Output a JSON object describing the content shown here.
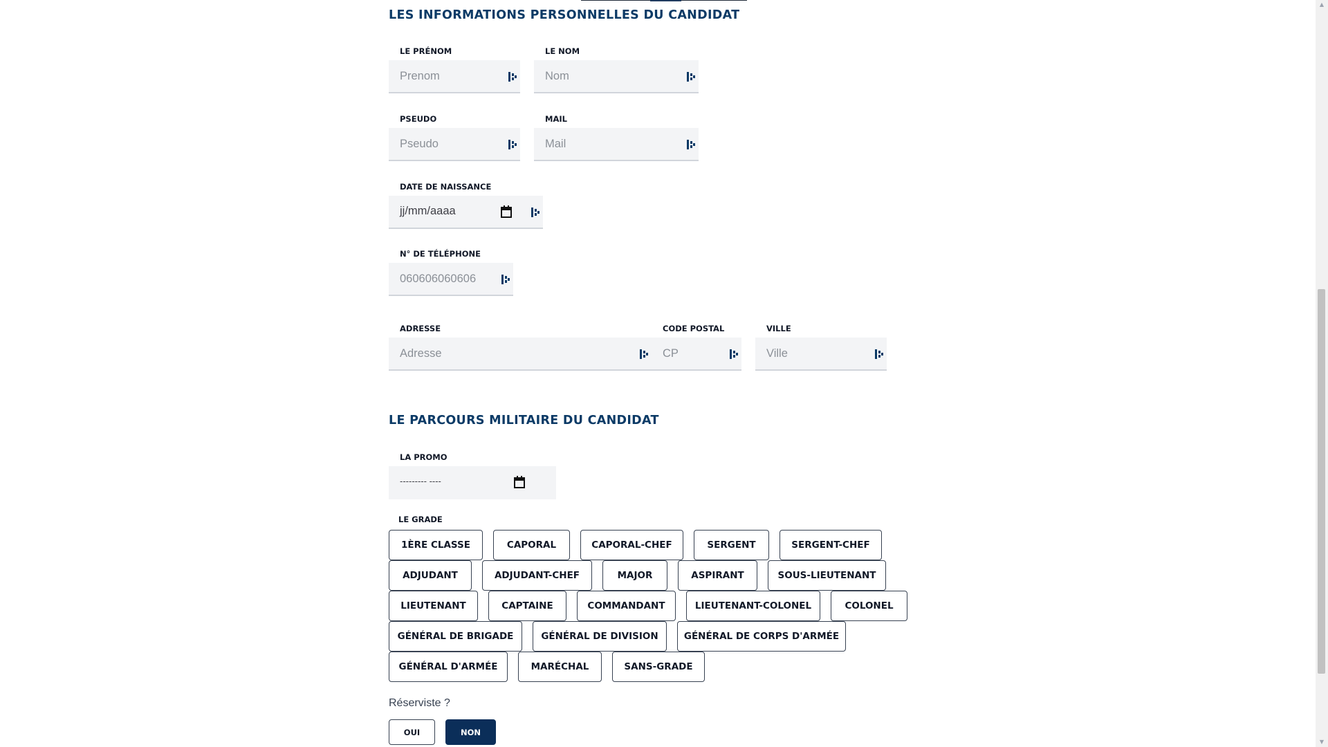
{
  "personal": {
    "title": "LES INFORMATIONS PERSONNELLES DU CANDIDAT",
    "firstname": {
      "label": "LE PRÉNOM",
      "placeholder": "Prenom"
    },
    "lastname": {
      "label": "LE NOM",
      "placeholder": "Nom"
    },
    "pseudo": {
      "label": "PSEUDO",
      "placeholder": "Pseudo"
    },
    "mail": {
      "label": "MAIL",
      "placeholder": "Mail"
    },
    "birthdate": {
      "label": "DATE DE NAISSANCE",
      "placeholder": "jj/mm/aaaa"
    },
    "phone": {
      "label": "N° DE TÉLÉPHONE",
      "placeholder": "060606060606"
    },
    "address": {
      "label": "ADRESSE",
      "placeholder": "Adresse"
    },
    "postal": {
      "label": "CODE POSTAL",
      "placeholder": "CP"
    },
    "city": {
      "label": "VILLE",
      "placeholder": "Ville"
    }
  },
  "military": {
    "title": "LE PARCOURS MILITAIRE DU CANDIDAT",
    "promo": {
      "label": "LA PROMO",
      "placeholder": "--------- ----"
    },
    "grade_label": "LE GRADE",
    "grades": [
      "1ÈRE CLASSE",
      "CAPORAL",
      "CAPORAL-CHEF",
      "SERGENT",
      "SERGENT-CHEF",
      "ADJUDANT",
      "ADJUDANT-CHEF",
      "MAJOR",
      "ASPIRANT",
      "SOUS-LIEUTENANT",
      "LIEUTENANT",
      "CAPTAINE",
      "COMMANDANT",
      "LIEUTENANT-COLONEL",
      "COLONEL",
      "GÉNÉRAL DE BRIGADE",
      "GÉNÉRAL DE DIVISION",
      "GÉNÉRAL DE CORPS D'ARMÉE",
      "GÉNÉRAL D'ARMÉE",
      "MARÉCHAL",
      "SANS-GRADE"
    ],
    "reservist": {
      "question": "Réserviste ?",
      "yes": "OUI",
      "no": "NON",
      "selected": "NON"
    }
  },
  "icons": {
    "field_icon": "password-manager-key-icon",
    "date_icon": "calendar-icon"
  },
  "colors": {
    "heading": "#0b3a66",
    "selected_button": "#0b2e59",
    "field_background": "#f3f4f6"
  }
}
